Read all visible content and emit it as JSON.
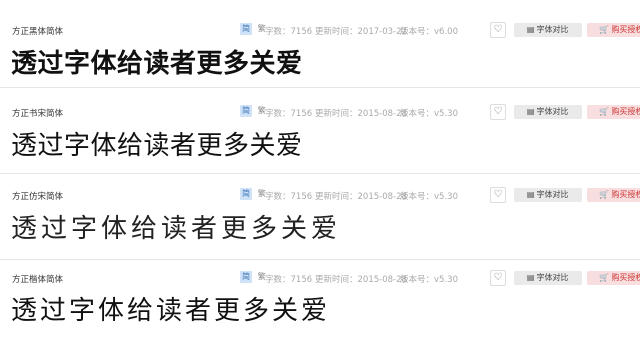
{
  "labels": {
    "simp_badge": "简",
    "trad_badge": "繁",
    "count_label": "字数：",
    "date_label": "更新时间：",
    "version_label": "版本号：",
    "fav_icon": "♡",
    "compare_label": "字体对比",
    "buy_label": "购买授权"
  },
  "fonts": [
    {
      "name": "方正黑体简体",
      "count": "7156",
      "date": "2017-03-22",
      "version": "v6.00",
      "preview": "透过字体给读者更多关爱"
    },
    {
      "name": "方正书宋简体",
      "count": "7156",
      "date": "2015-08-28",
      "version": "v5.30",
      "preview": "透过字体给读者更多关爱"
    },
    {
      "name": "方正仿宋简体",
      "count": "7156",
      "date": "2015-08-28",
      "version": "v5.30",
      "preview": "透过字体给读者更多关爱"
    },
    {
      "name": "方正楷体简体",
      "count": "7156",
      "date": "2015-08-28",
      "version": "v5.30",
      "preview": "透过字体给读者更多关爱"
    }
  ]
}
